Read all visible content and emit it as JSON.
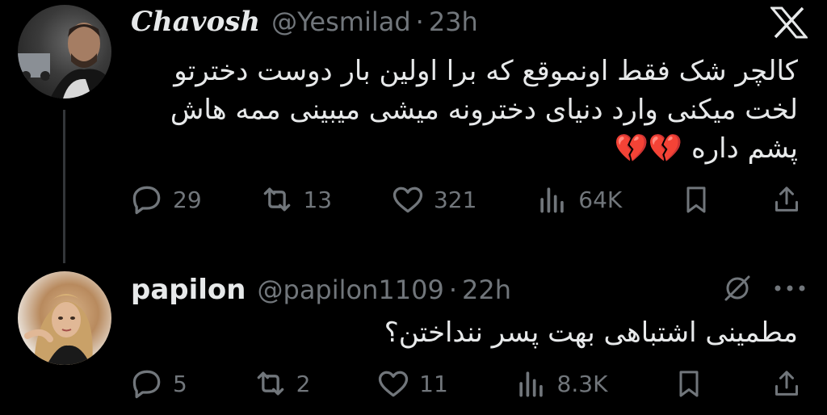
{
  "colors": {
    "background": "#000000",
    "text": "#e7e9ea",
    "muted": "#71767b",
    "thread_line": "#333639"
  },
  "tweets": [
    {
      "display_name": "Chavosh",
      "handle": "@Yesmilad",
      "dot": "·",
      "time": "23h",
      "brand_icon": "x-logo-icon",
      "text": "کالچر شک فقط اونموقع که برا اولین بار دوست دخترتو\nلخت میکنی وارد دنیای دخترونه میشی میبینی ممه هاش\nپشم داره 💔💔",
      "replies": "29",
      "reposts": "13",
      "likes": "321",
      "views": "64K"
    },
    {
      "display_name": "papilon",
      "handle": "@papilon1109",
      "dot": "·",
      "time": "22h",
      "text": "مطمینی اشتباهی بهت پسر ننداختن؟",
      "replies": "5",
      "reposts": "2",
      "likes": "11",
      "views": "8.3K"
    }
  ]
}
